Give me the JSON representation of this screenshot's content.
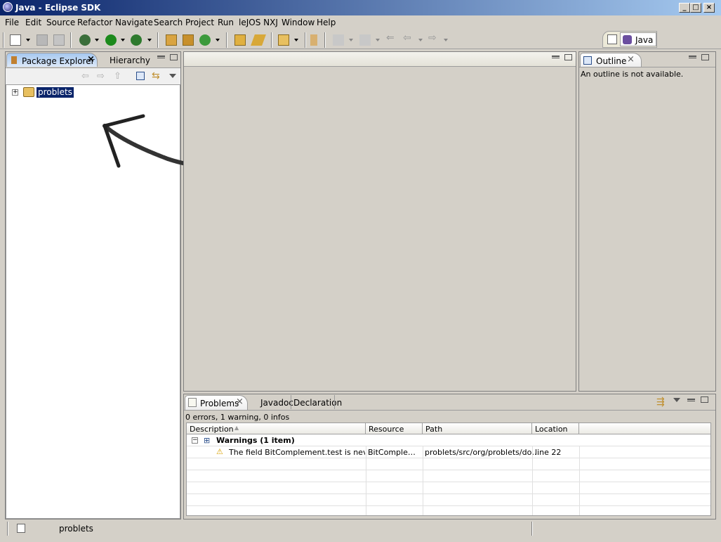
{
  "window": {
    "title": "Java - Eclipse SDK",
    "buttons": [
      "_",
      "□",
      "×"
    ]
  },
  "menu": [
    "File",
    "Edit",
    "Source",
    "Refactor",
    "Navigate",
    "Search",
    "Project",
    "Run",
    "leJOS NXJ",
    "Window",
    "Help"
  ],
  "perspective": {
    "label": "Java"
  },
  "package_explorer": {
    "tabs": [
      "Package Explorer",
      "Hierarchy"
    ],
    "tree": [
      {
        "label": "problets",
        "expanded": false,
        "selected": true
      }
    ]
  },
  "outline": {
    "tab": "Outline",
    "message": "An outline is not available."
  },
  "problems": {
    "tabs": [
      "Problems",
      "Javadoc",
      "Declaration"
    ],
    "summary": "0 errors, 1 warning, 0 infos",
    "columns": [
      "Description",
      "Resource",
      "Path",
      "Location"
    ],
    "group": "Warnings (1 item)",
    "rows": [
      {
        "description": "The field BitComplement.test is never re",
        "resource": "BitComple…",
        "path": "problets/src/org/problets/do…",
        "location": "line 22"
      }
    ]
  },
  "status": {
    "text": "problets"
  },
  "colors": {
    "title_start": "#0a246a",
    "title_end": "#a6caf0",
    "chrome": "#d4d0c8",
    "selection": "#0a246a"
  }
}
